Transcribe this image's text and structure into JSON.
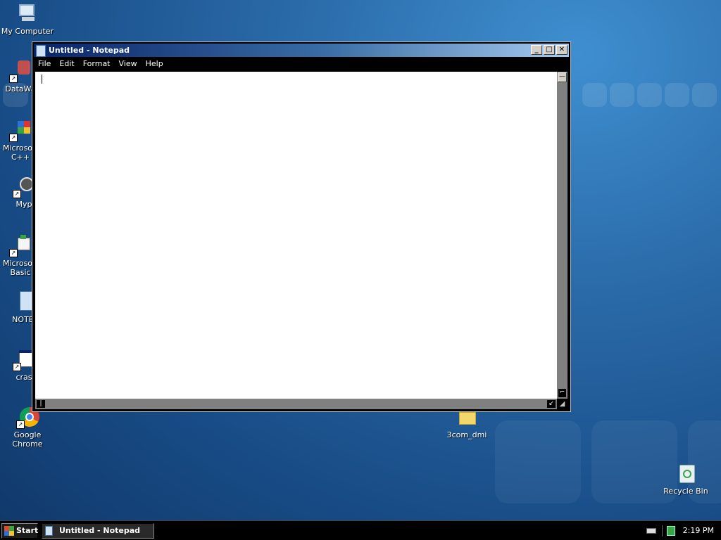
{
  "desktop": {
    "icons": [
      {
        "label": "My Computer"
      },
      {
        "label": "DataWa"
      },
      {
        "label": "Microsoft",
        "label2": "C++"
      },
      {
        "label": "Myp"
      },
      {
        "label": "Microsoft",
        "label2": "Basic"
      },
      {
        "label": "NOTEI"
      },
      {
        "label": "cras"
      },
      {
        "label": "Google Chrome"
      },
      {
        "label": "3com_dmi"
      },
      {
        "label": "Recycle Bin"
      }
    ]
  },
  "window": {
    "title": "Untitled - Notepad",
    "menu": [
      "File",
      "Edit",
      "Format",
      "View",
      "Help"
    ],
    "content": ""
  },
  "taskbar": {
    "start_label": "Start",
    "task_label": "Untitled - Notepad",
    "clock": "2:19 PM"
  }
}
